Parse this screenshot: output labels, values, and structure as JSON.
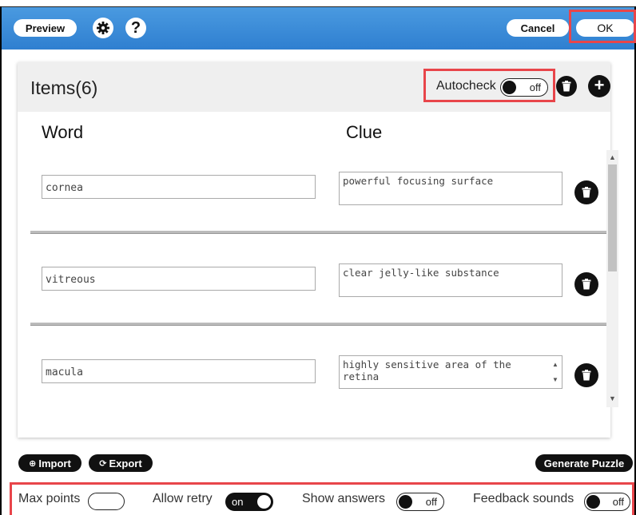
{
  "header": {
    "preview_label": "Preview",
    "cancel_label": "Cancel",
    "ok_label": "OK"
  },
  "items_panel": {
    "title": "Items(6)",
    "autocheck_label": "Autocheck",
    "autocheck_state": "off",
    "col_word": "Word",
    "col_clue": "Clue",
    "rows": [
      {
        "word": "cornea",
        "clue": "powerful focusing surface"
      },
      {
        "word": "vitreous",
        "clue": "clear jelly-like substance"
      },
      {
        "word": "macula",
        "clue": "highly sensitive area of the\nretina"
      }
    ]
  },
  "actions": {
    "import_label": "Import",
    "export_label": "Export",
    "generate_label": "Generate Puzzle"
  },
  "footer": {
    "max_points_label": "Max points",
    "max_points_value": "",
    "allow_retry_label": "Allow retry",
    "allow_retry_state": "on",
    "show_answers_label": "Show answers",
    "show_answers_state": "off",
    "feedback_sounds_label": "Feedback sounds",
    "feedback_sounds_state": "off"
  },
  "colors": {
    "header_blue": "#3a8ad8",
    "highlight_red": "#e8454a",
    "panel_header": "#efefef"
  },
  "icons": [
    "gear-icon",
    "help-icon",
    "trash-icon",
    "plus-icon",
    "import-icon",
    "export-icon"
  ]
}
